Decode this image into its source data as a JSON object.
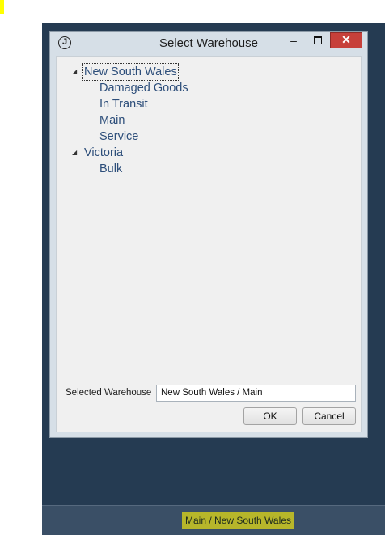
{
  "window": {
    "title": "Select Warehouse",
    "logo_glyph": "J",
    "minimize_glyph": "–",
    "close_glyph": "✕"
  },
  "tree": {
    "nodes": [
      {
        "label": "New South Wales",
        "expanded": true,
        "selected": true,
        "children": [
          "Damaged Goods",
          "In Transit",
          "Main",
          "Service"
        ]
      },
      {
        "label": "Victoria",
        "expanded": true,
        "selected": false,
        "children": [
          "Bulk"
        ]
      }
    ],
    "expander_glyph": "◢"
  },
  "selected_warehouse": {
    "label": "Selected Warehouse",
    "value": "New South Wales / Main"
  },
  "buttons": {
    "ok": "OK",
    "cancel": "Cancel"
  },
  "status_bar": {
    "text": "Main / New South Wales"
  },
  "colors": {
    "app_background": "#253b52",
    "close_button": "#c7403a",
    "tree_text": "#2d4e7a",
    "status_highlight": "#b7b62a"
  }
}
